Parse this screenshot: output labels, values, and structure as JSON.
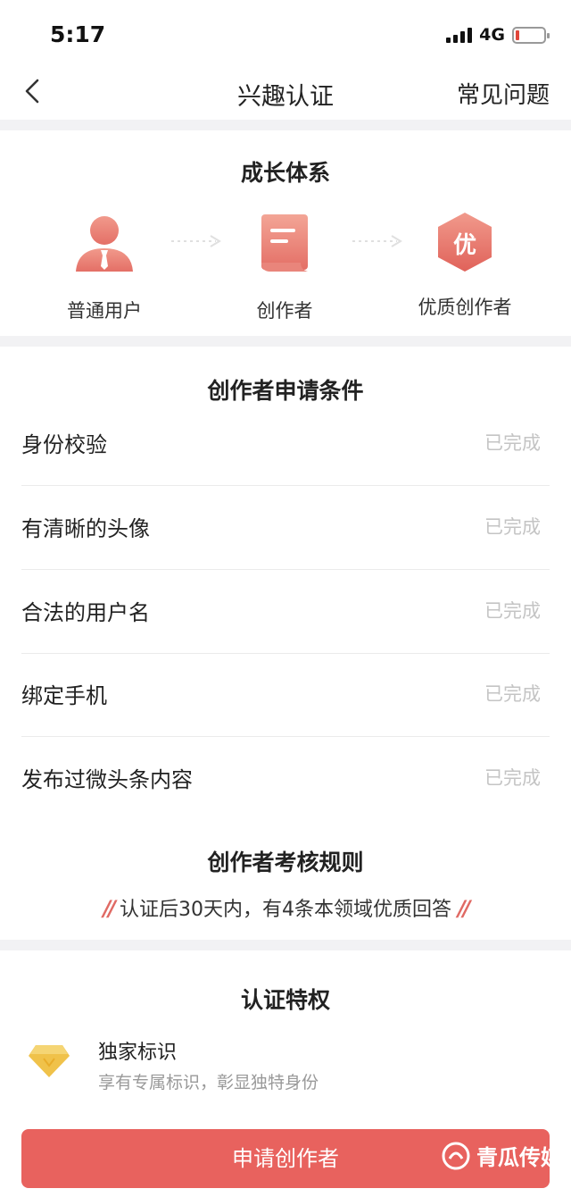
{
  "status_bar": {
    "time": "5:17",
    "network": "4G"
  },
  "nav": {
    "title": "兴趣认证",
    "faq": "常见问题"
  },
  "growth": {
    "title": "成长体系",
    "steps": [
      {
        "label": "普通用户",
        "icon": "user-icon"
      },
      {
        "label": "创作者",
        "icon": "document-icon"
      },
      {
        "label": "优质创作者",
        "icon": "quality-badge-icon",
        "badge_text": "优"
      }
    ]
  },
  "conditions": {
    "title": "创作者申请条件",
    "items": [
      {
        "name": "身份校验",
        "status": "已完成"
      },
      {
        "name": "有清晰的头像",
        "status": "已完成"
      },
      {
        "name": "合法的用户名",
        "status": "已完成"
      },
      {
        "name": "绑定手机",
        "status": "已完成"
      },
      {
        "name": "发布过微头条内容",
        "status": "已完成"
      }
    ]
  },
  "rules": {
    "title": "创作者考核规则",
    "text": "认证后30天内，有4条本领域优质回答"
  },
  "privileges": {
    "title": "认证特权",
    "items": [
      {
        "name": "独家标识",
        "desc": "享有专属标识，彰显独特身份",
        "icon": "diamond-icon"
      }
    ]
  },
  "apply_button": "申请创作者",
  "watermark": "青瓜传媒",
  "colors": {
    "accent": "#e8625e",
    "muted": "#c4c4c4"
  }
}
